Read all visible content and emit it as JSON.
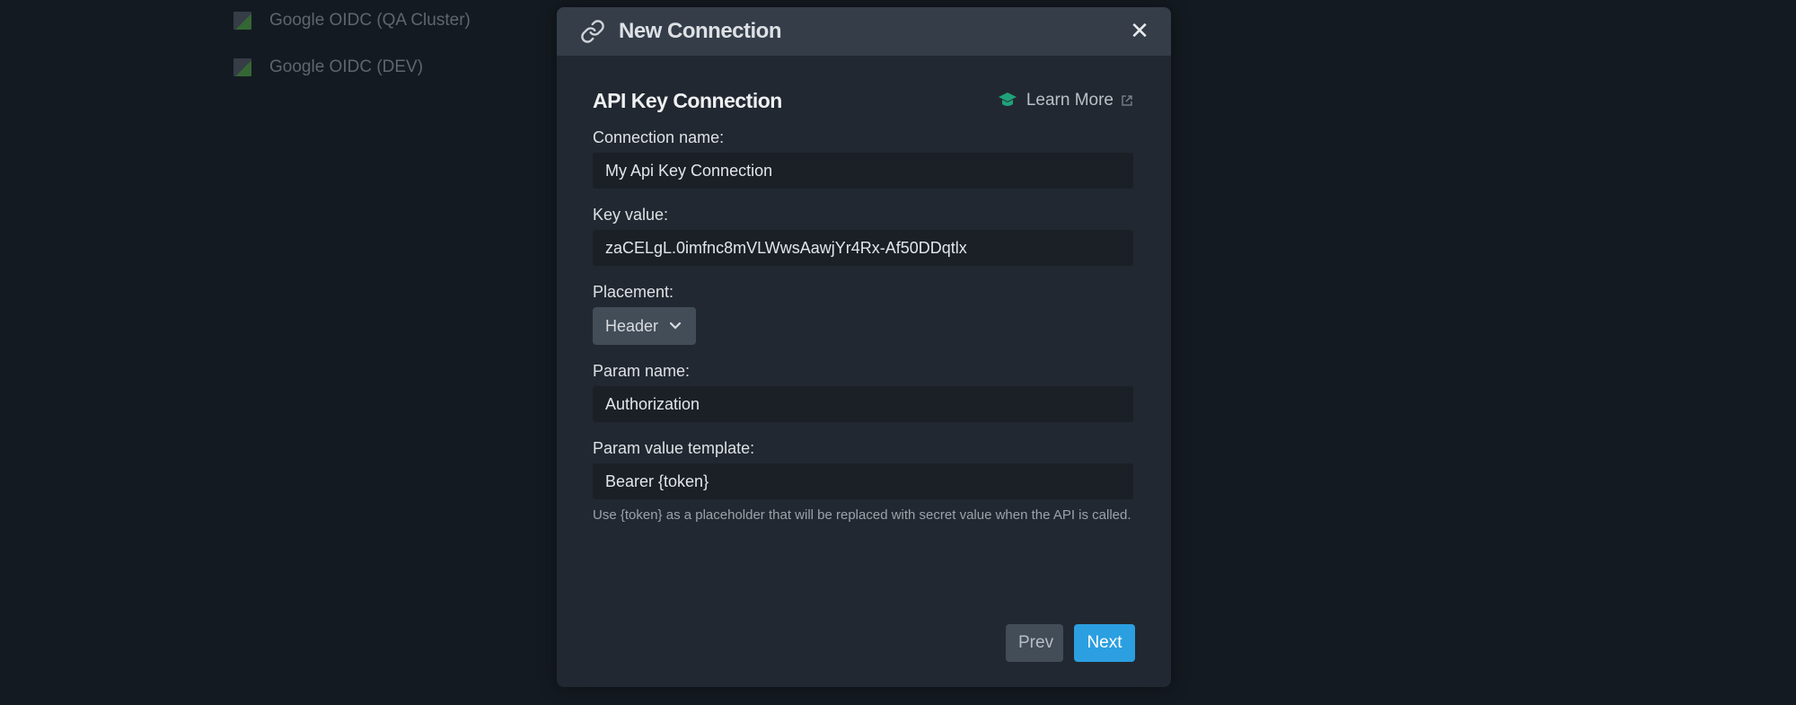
{
  "background_list": {
    "items": [
      {
        "label": "Google OIDC (QA Cluster)",
        "icon": "broken-image-icon"
      },
      {
        "label": "Google OIDC (DEV)",
        "icon": "broken-image-icon"
      }
    ]
  },
  "modal": {
    "title": "New Connection",
    "title_icon": "link-icon",
    "close_icon": "close-icon",
    "close_glyph": "✕",
    "section_title": "API Key Connection",
    "learn_more": {
      "label": "Learn More",
      "icon": "graduation-cap-icon",
      "external_icon": "external-link-icon",
      "icon_color": "#1fa37a"
    },
    "fields": {
      "connection_name": {
        "label": "Connection name:",
        "value": "My Api Key Connection"
      },
      "key_value": {
        "label": "Key value:",
        "value": "zaCELgL.0imfnc8mVLWwsAawjYr4Rx-Af50DDqtlx"
      },
      "placement": {
        "label": "Placement:",
        "selected": "Header"
      },
      "param_name": {
        "label": "Param name:",
        "value": "Authorization"
      },
      "param_value_template": {
        "label": "Param value template:",
        "value": "Bearer {token}",
        "help": "Use {token} as a placeholder that will be replaced with secret value when the API is called."
      }
    },
    "buttons": {
      "prev": "Prev",
      "next": "Next"
    },
    "colors": {
      "accent": "#2b9fe0",
      "header_bg": "#343d48",
      "body_bg": "#222831"
    }
  }
}
